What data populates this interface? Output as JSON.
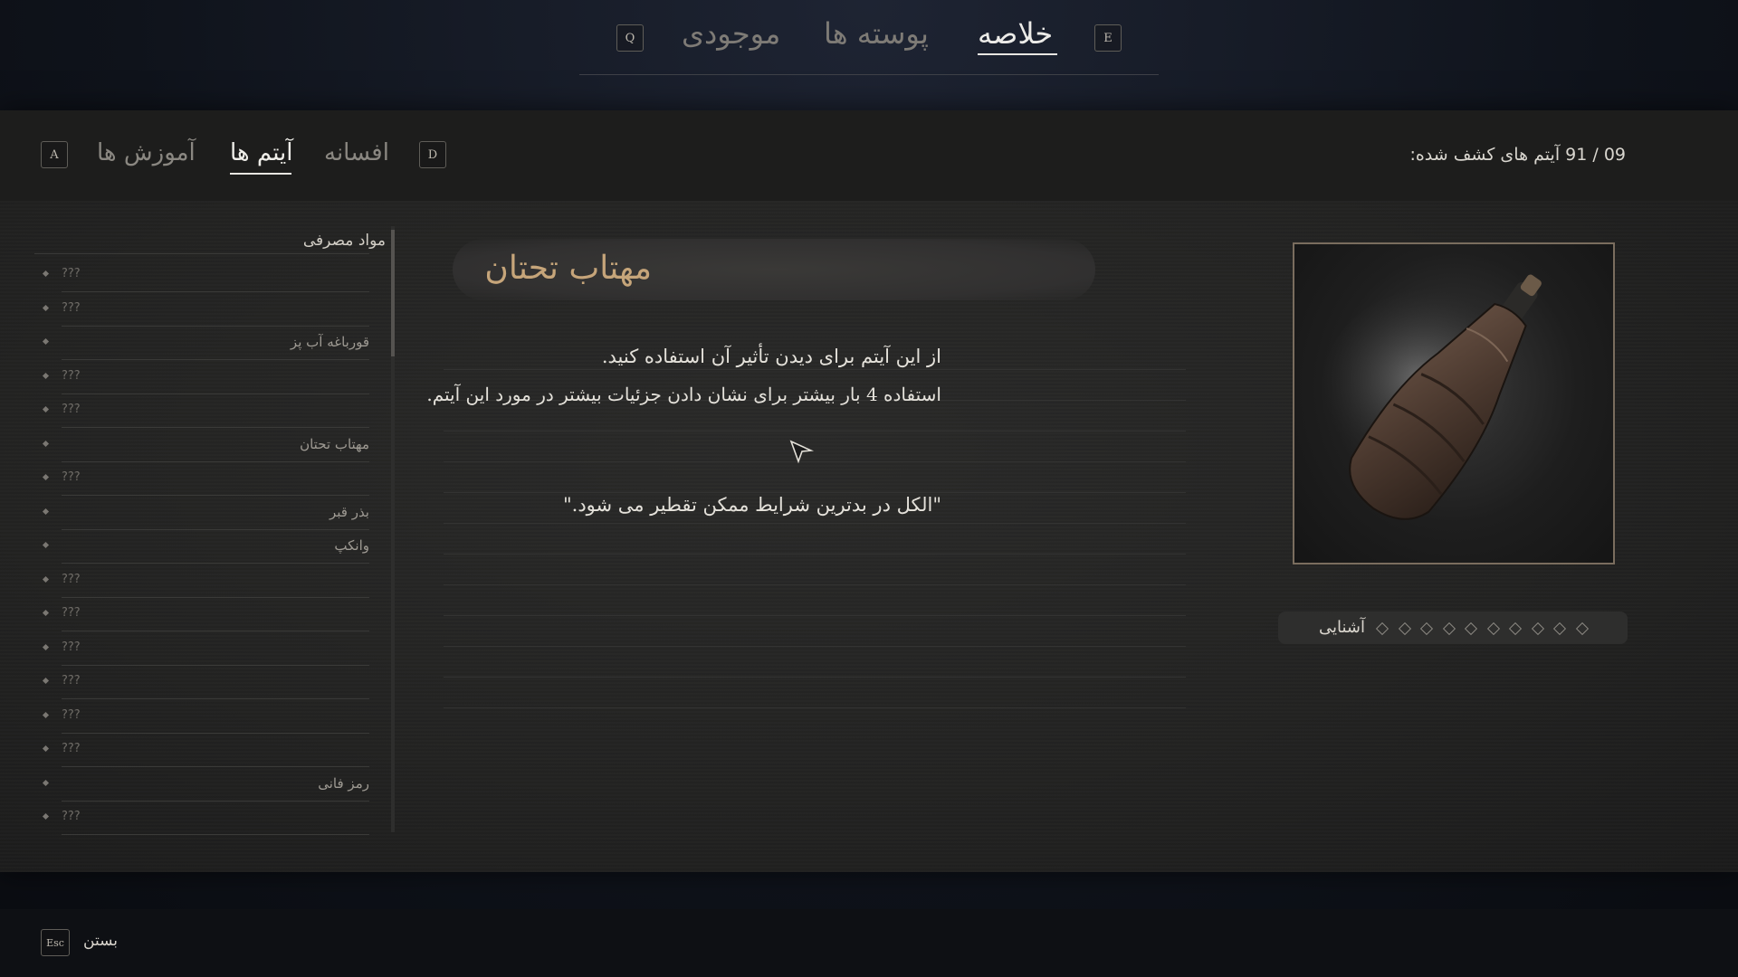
{
  "top_nav": {
    "left_key": "Q",
    "right_key": "E",
    "tabs": [
      {
        "label": "موجودی"
      },
      {
        "label": "پوسته ها"
      },
      {
        "label": "خلاصه"
      }
    ],
    "active_tab": "خلاصه"
  },
  "sub_nav": {
    "left_key": "A",
    "right_key": "D",
    "tabs": [
      {
        "label": "آموزش ها"
      },
      {
        "label": "آیتم ها"
      },
      {
        "label": "افسانه"
      }
    ],
    "active_tab": "آیتم ها",
    "discovered_text": "09 / 91 آیتم های کشف شده:"
  },
  "item_list": {
    "category": "مواد مصرفی",
    "rows": [
      {
        "label": "???"
      },
      {
        "label": "???"
      },
      {
        "label": "قورباغه آب پز"
      },
      {
        "label": "???"
      },
      {
        "label": "???"
      },
      {
        "label": "مهتاب تحتان"
      },
      {
        "label": "???"
      },
      {
        "label": "بذر قبر"
      },
      {
        "label": "وانکپ"
      },
      {
        "label": "???"
      },
      {
        "label": "???"
      },
      {
        "label": "???"
      },
      {
        "label": "???"
      },
      {
        "label": "???"
      },
      {
        "label": "???"
      },
      {
        "label": "رمز فانی"
      },
      {
        "label": "???"
      }
    ]
  },
  "detail": {
    "title": "مهتاب تحتان",
    "description_1": "از این آیتم برای دیدن تأثیر آن استفاده کنید.",
    "description_2": "استفاده 4 بار بیشتر برای نشان دادن جزئیات بیشتر در مورد این آیتم.",
    "quote": "\"الکل در بدترین شرایط ممکن تقطیر می شود.\"",
    "familiarity_label": "آشنایی",
    "familiarity_level": 0,
    "familiarity_max": 10
  },
  "footer": {
    "esc_key": "Esc",
    "close_label": "بستن"
  },
  "colors": {
    "title_gold": "#c6a57a",
    "frame_border": "#7a6d5e",
    "active_text": "#ecebe8",
    "inactive_text": "#7e7b76"
  },
  "icons": {
    "item_image": "wrapped-leather-flask-icon",
    "cursor": "arrow-cursor-icon",
    "bullet": "diamond-bullet-icon"
  }
}
